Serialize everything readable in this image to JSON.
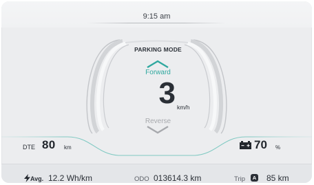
{
  "status": {
    "time": "9:15 am"
  },
  "drive": {
    "mode_title": "PARKING MODE",
    "forward_label": "Forward",
    "reverse_label": "Reverse",
    "speed": "3",
    "speed_unit": "km/h"
  },
  "range": {
    "label": "DTE",
    "value": "80",
    "unit": "km"
  },
  "battery": {
    "value": "70",
    "unit": "%",
    "icon": "battery-icon"
  },
  "footer": {
    "avg_label": "Avg.",
    "avg_value": "12.2 Wh/km",
    "odo_label": "ODO",
    "odo_value": "013614.3 km",
    "trip_label": "Trip",
    "trip_badge": "A",
    "trip_value": "85 km",
    "bolt_icon": "bolt-icon"
  },
  "colors": {
    "accent": "#2fa89f",
    "text": "#2a2f36",
    "background": "#ecedef",
    "muted": "#a7a9ad"
  }
}
